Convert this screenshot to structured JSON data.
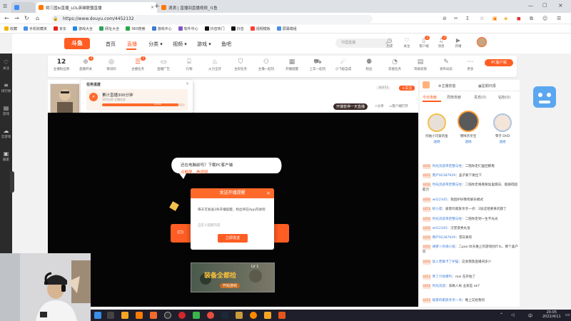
{
  "browser": {
    "tabs": [
      {
        "title": "祠三国bi直播_LOL英雄联盟直播"
      },
      {
        "title": "滴滴 | 直播间直播视频_斗鱼"
      }
    ],
    "new_tab": "+",
    "url": "https://www.douyu.com/4452132",
    "bookmarks": [
      "收藏",
      "手机收藏夹",
      "京东",
      "游戏大全",
      "网址大全",
      "360搜索",
      "游戏中心",
      "软件中心",
      "抖音热门",
      "抖音",
      "视频模板",
      "屏幕模组"
    ]
  },
  "sidebar": {
    "items": [
      {
        "label": "关注",
        "icon": "heart-icon"
      },
      {
        "label": "排行榜",
        "icon": "rank-icon"
      },
      {
        "label": "游戏",
        "icon": "gamepad-icon"
      },
      {
        "label": "云游戏",
        "icon": "cloud-game-icon"
      },
      {
        "label": "搬家",
        "icon": "box-icon"
      }
    ]
  },
  "header": {
    "logo": "斗鱼",
    "nav": [
      "首页",
      "直播",
      "分类",
      "视频",
      "游戏",
      "鱼吧"
    ],
    "nav_active": "直播",
    "search_placeholder": "中国直播",
    "icons": [
      {
        "label": "历史",
        "icon": "clock-icon"
      },
      {
        "label": "关注",
        "icon": "heart-icon"
      },
      {
        "label": "客户端",
        "icon": "phone-icon",
        "badge": "2"
      },
      {
        "label": "消息",
        "icon": "bell-icon",
        "badge": "3"
      },
      {
        "label": "开播",
        "icon": "camera-icon"
      }
    ]
  },
  "toolbar": {
    "level_num": "12",
    "level_label": "主播粉丝牌",
    "items": [
      {
        "label": "直播开关",
        "icon": "power-icon",
        "badge": "3"
      },
      {
        "label": "情况码",
        "icon": "signal-icon"
      },
      {
        "label": "主播任务",
        "icon": "task-icon",
        "badge": "1"
      },
      {
        "label": "直播广告",
        "icon": "ad-icon"
      },
      {
        "label": "礼物",
        "icon": "gift-icon"
      },
      {
        "label": "火力全开",
        "icon": "fire-icon"
      },
      {
        "label": "主权任务",
        "icon": "shield-icon"
      },
      {
        "label": "主播一起玩",
        "icon": "game-icon"
      },
      {
        "label": "开播提醒",
        "icon": "remind-icon"
      },
      {
        "label": "上车一起玩",
        "icon": "car-icon"
      },
      {
        "label": "小飞船自成",
        "icon": "ship-icon"
      },
      {
        "label": "粉丝",
        "icon": "fans-icon"
      },
      {
        "label": "充能任务",
        "icon": "energy-icon"
      },
      {
        "label": "等级权限",
        "icon": "level-icon"
      },
      {
        "label": "发布动态",
        "icon": "edit-icon"
      },
      {
        "label": "更多",
        "icon": "more-icon"
      }
    ],
    "pc_button": "PC客户端"
  },
  "task_popup": {
    "title": "任务进度",
    "task_name": "累计直播300分钟",
    "task_sub": "300分钟 主播任务",
    "progress_text": "0/300",
    "progress": 0.92
  },
  "streamer": {
    "name": "2",
    "name_tag": "鱼吧",
    "fans": "30371",
    "follow_label": "关注",
    "share_label": "分享",
    "client_label": "客户端打开",
    "like_tag": "开播暂停一天直播"
  },
  "video": {
    "bubble_text_1": "还在电脑前吗？下载PC客户端",
    "bubble_text_2": "点触屏，看视频",
    "ad_title": "装备全都捡",
    "ad_level": "LV 1",
    "ad_button": "开始游戏"
  },
  "dialog": {
    "title": "发送开播提醒",
    "close": "×",
    "body": "每天可发送3条开播提醒，粉丝将在App内收到",
    "input_placeholder": "自定义提醒内容",
    "button": "立即发送"
  },
  "right_panel": {
    "top_tag": "今日贡献",
    "top_items": [
      "主播技能",
      "星期日报"
    ],
    "tabs": [
      "今日贡献",
      "周榜贡献",
      "贵宾(0)",
      "钻粉(0)"
    ],
    "rank": [
      {
        "name": "阿姑小可爱的鱼",
        "badge": "送她"
      },
      {
        "name": "哦咪亲亲宝",
        "badge": "送她"
      },
      {
        "name": "零子 DVD",
        "badge": "送她"
      }
    ],
    "chat": [
      {
        "lv": "LV16",
        "name": "时光流逝带走整与经",
        "text": "二陪你走们里团那看"
      },
      {
        "lv": "LV15",
        "name": "用户92387929",
        "text": "盖子要下要出下"
      },
      {
        "lv": "LV16",
        "name": "时光流逝带走整与经",
        "text": "二陪你走咯看要加里跑向、能跟得超能力"
      },
      {
        "lv": "LV16",
        "name": "wll12345",
        "text": "抱团护好像有解乐模式"
      },
      {
        "lv": "LV13",
        "name": "标小莲",
        "text": "极客的家族亲亲一点：2加这哈要来问题了"
      },
      {
        "lv": "LV16",
        "name": "时光流逝带走整与经",
        "text": "二陪你走到一生不光光"
      },
      {
        "lv": "LV16",
        "name": "wll12345",
        "text": "汉堡夜秀丸涨"
      },
      {
        "lv": "LV16",
        "name": "用户92387929",
        "text": "雪日真有"
      },
      {
        "lv": "LV10",
        "name": "胡萝卜的海小班",
        "text": "二pao 坟天难上的游戏别什么，那个喜户欢"
      },
      {
        "lv": "LV10",
        "name": "加入老桑卡了护猫",
        "text": "这会我放直播间多少"
      },
      {
        "lv": "LV13",
        "name": "青了只你哦呜",
        "text": "mai 在开始了"
      },
      {
        "lv": "LV14",
        "name": "时光流逝",
        "text": "非路人局 业某是 ok7"
      },
      {
        "lv": "LV13",
        "name": "极客的家族亲亲一点",
        "text": "晚上又给我烈"
      }
    ]
  },
  "taskbar": {
    "time": "20:05",
    "date": "2022/4/11",
    "lang": "中"
  }
}
